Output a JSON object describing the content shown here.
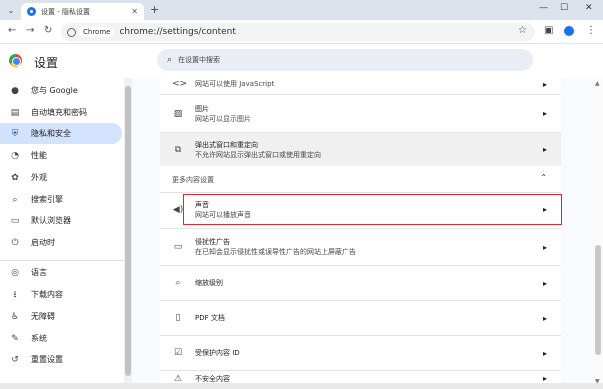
{
  "browser": {
    "tab_title": "设置 - 隐私设置",
    "chip_label": "Chrome",
    "url": "chrome://settings/content"
  },
  "settings": {
    "title": "设置",
    "search_placeholder": "在设置中搜索"
  },
  "sidebar": {
    "items": [
      {
        "label": "您与 Google",
        "icon": "person-icon"
      },
      {
        "label": "自动填充和密码",
        "icon": "clipboard-icon"
      },
      {
        "label": "隐私和安全",
        "icon": "shield-icon",
        "active": true
      },
      {
        "label": "性能",
        "icon": "speedometer-icon"
      },
      {
        "label": "外观",
        "icon": "palette-icon"
      },
      {
        "label": "搜索引擎",
        "icon": "search-icon"
      },
      {
        "label": "默认浏览器",
        "icon": "browser-icon"
      },
      {
        "label": "启动时",
        "icon": "power-icon"
      },
      {
        "label": "语言",
        "icon": "globe-icon"
      },
      {
        "label": "下载内容",
        "icon": "download-icon"
      },
      {
        "label": "无障碍",
        "icon": "accessibility-icon"
      },
      {
        "label": "系统",
        "icon": "wrench-icon"
      },
      {
        "label": "重置设置",
        "icon": "reset-icon"
      }
    ]
  },
  "content": {
    "javascript_desc": "网站可以使用 JavaScript",
    "images": {
      "title": "图片",
      "desc": "网站可以显示图片"
    },
    "popups": {
      "title": "弹出式窗口和重定向",
      "desc": "不允许网站显示弹出式窗口或使用重定向"
    },
    "more_section": "更多内容设置",
    "sound": {
      "title": "声音",
      "desc": "网站可以播放声音"
    },
    "intrusive_ads": {
      "title": "侵扰性广告",
      "desc": "在已知会显示侵扰性或误导性广告的网站上屏蔽广告"
    },
    "zoom": {
      "title": "缩放级别"
    },
    "pdf": {
      "title": "PDF 文档"
    },
    "protected_content": {
      "title": "受保护内容 ID"
    },
    "insecure_content": {
      "title": "不安全内容"
    }
  }
}
